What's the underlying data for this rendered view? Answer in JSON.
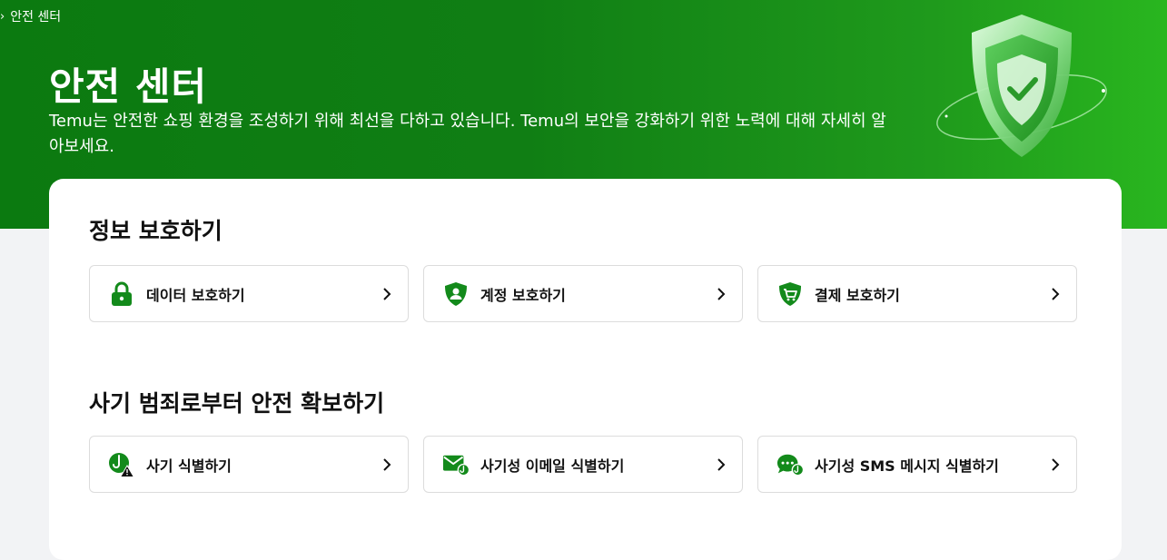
{
  "breadcrumb": {
    "separator": "›",
    "current": "안전 센터"
  },
  "hero": {
    "title": "안전 센터",
    "description": "Temu는 안전한 쇼핑 환경을 조성하기 위해 최선을 다하고 있습니다. Temu의 보안을 강화하기 위한 노력에 대해 자세히 알아보세요."
  },
  "sections": [
    {
      "title": "정보 보호하기",
      "items": [
        {
          "label": "데이터 보호하기",
          "icon": "lock-icon"
        },
        {
          "label": "계정 보호하기",
          "icon": "shield-user-icon"
        },
        {
          "label": "결제 보호하기",
          "icon": "shield-cart-icon"
        }
      ]
    },
    {
      "title": "사기 범죄로부터 안전 확보하기",
      "items": [
        {
          "label": "사기 식별하기",
          "icon": "hook-warning-icon"
        },
        {
          "label": "사기성 이메일 식별하기",
          "icon": "mail-hook-icon"
        },
        {
          "label": "사기성 SMS 메시지 식별하기",
          "icon": "chat-hook-icon"
        }
      ]
    }
  ],
  "colors": {
    "brand_green": "#0b7a10",
    "icon_green": "#138a1b",
    "background": "#f2f3f5"
  }
}
